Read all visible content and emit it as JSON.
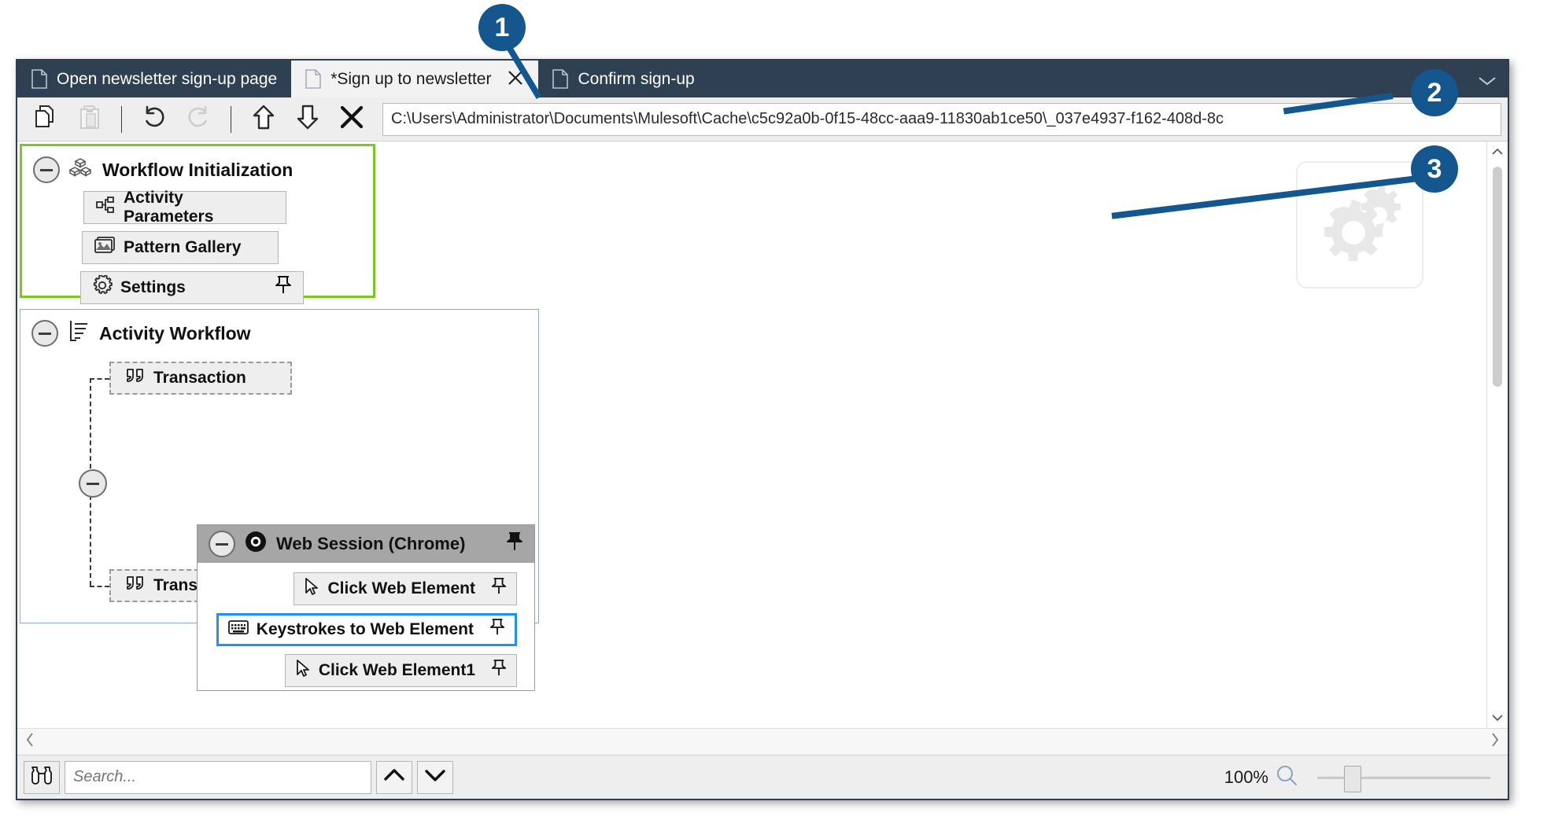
{
  "window": {
    "tabs": [
      {
        "label": "Open newsletter sign-up page",
        "active": false,
        "closable": false
      },
      {
        "label": "*Sign up to newsletter",
        "active": true,
        "closable": true
      },
      {
        "label": "Confirm sign-up",
        "active": false,
        "closable": false
      }
    ],
    "overflow_glyph": "⌵"
  },
  "toolbar": {
    "buttons": [
      {
        "name": "copy-button",
        "icon": "copy-icon",
        "enabled": true
      },
      {
        "name": "paste-button",
        "icon": "paste-icon",
        "enabled": false
      },
      {
        "name": "undo-button",
        "icon": "undo-icon",
        "enabled": true
      },
      {
        "name": "redo-button",
        "icon": "redo-icon",
        "enabled": false
      },
      {
        "name": "move-up-button",
        "icon": "arrow-up-icon",
        "enabled": true
      },
      {
        "name": "move-down-button",
        "icon": "arrow-down-icon",
        "enabled": true
      },
      {
        "name": "delete-button",
        "icon": "close-x-icon",
        "enabled": true
      }
    ],
    "address_value": "C:\\Users\\Administrator\\Documents\\Mulesoft\\Cache\\c5c92a0b-0f15-48cc-aaa9-11830ab1ce50\\_037e4937-f162-408d-8c"
  },
  "canvas": {
    "workflow_initialization": {
      "title": "Workflow Initialization",
      "icon": "blocks-icon",
      "collapse_icon": "collapse-minus-icon",
      "border_color": "#7ac91e",
      "items": [
        {
          "label": "Activity Parameters",
          "icon": "parameters-icon",
          "pinned": false
        },
        {
          "label": "Pattern Gallery",
          "icon": "gallery-icon",
          "pinned": false
        },
        {
          "label": "Settings",
          "icon": "gear-icon",
          "pinned": true
        }
      ]
    },
    "activity_workflow": {
      "title": "Activity Workflow",
      "icon": "list-icon",
      "collapse_icon": "collapse-minus-icon",
      "border_color": "#8fa7d4",
      "transaction_top": {
        "label": "Transaction",
        "icon": "quote-icon"
      },
      "transaction_bottom": {
        "label": "Transaction",
        "icon": "quote-icon"
      }
    },
    "web_session": {
      "title": "Web Session (Chrome)",
      "icon": "chrome-icon",
      "collapse_icon": "collapse-minus-icon",
      "pinned": true,
      "header_color": "#a6a6a6",
      "selection_color": "#1f90ff",
      "items": [
        {
          "label": "Click Web Element",
          "icon": "cursor-icon",
          "pinned": true,
          "selected": false
        },
        {
          "label": "Keystrokes to Web Element",
          "icon": "keyboard-icon",
          "pinned": true,
          "selected": true
        },
        {
          "label": "Click Web Element1",
          "icon": "cursor-icon",
          "pinned": true,
          "selected": false
        }
      ]
    },
    "watermark": {
      "icon": "gears-watermark-icon"
    }
  },
  "scrollbars": {
    "vertical_up_glyph": "⌃",
    "vertical_down_glyph": "⌄",
    "horizontal_left_glyph": "‹",
    "horizontal_right_glyph": "›"
  },
  "statusbar": {
    "search_icon": "binoculars-icon",
    "search_placeholder": "Search...",
    "search_value": "",
    "prev_match_icon": "chevron-up-icon",
    "next_match_icon": "chevron-down-icon",
    "zoom_level": "100%",
    "zoom_icon": "magnifier-icon"
  },
  "callouts": [
    {
      "number": "1"
    },
    {
      "number": "2"
    },
    {
      "number": "3"
    }
  ]
}
